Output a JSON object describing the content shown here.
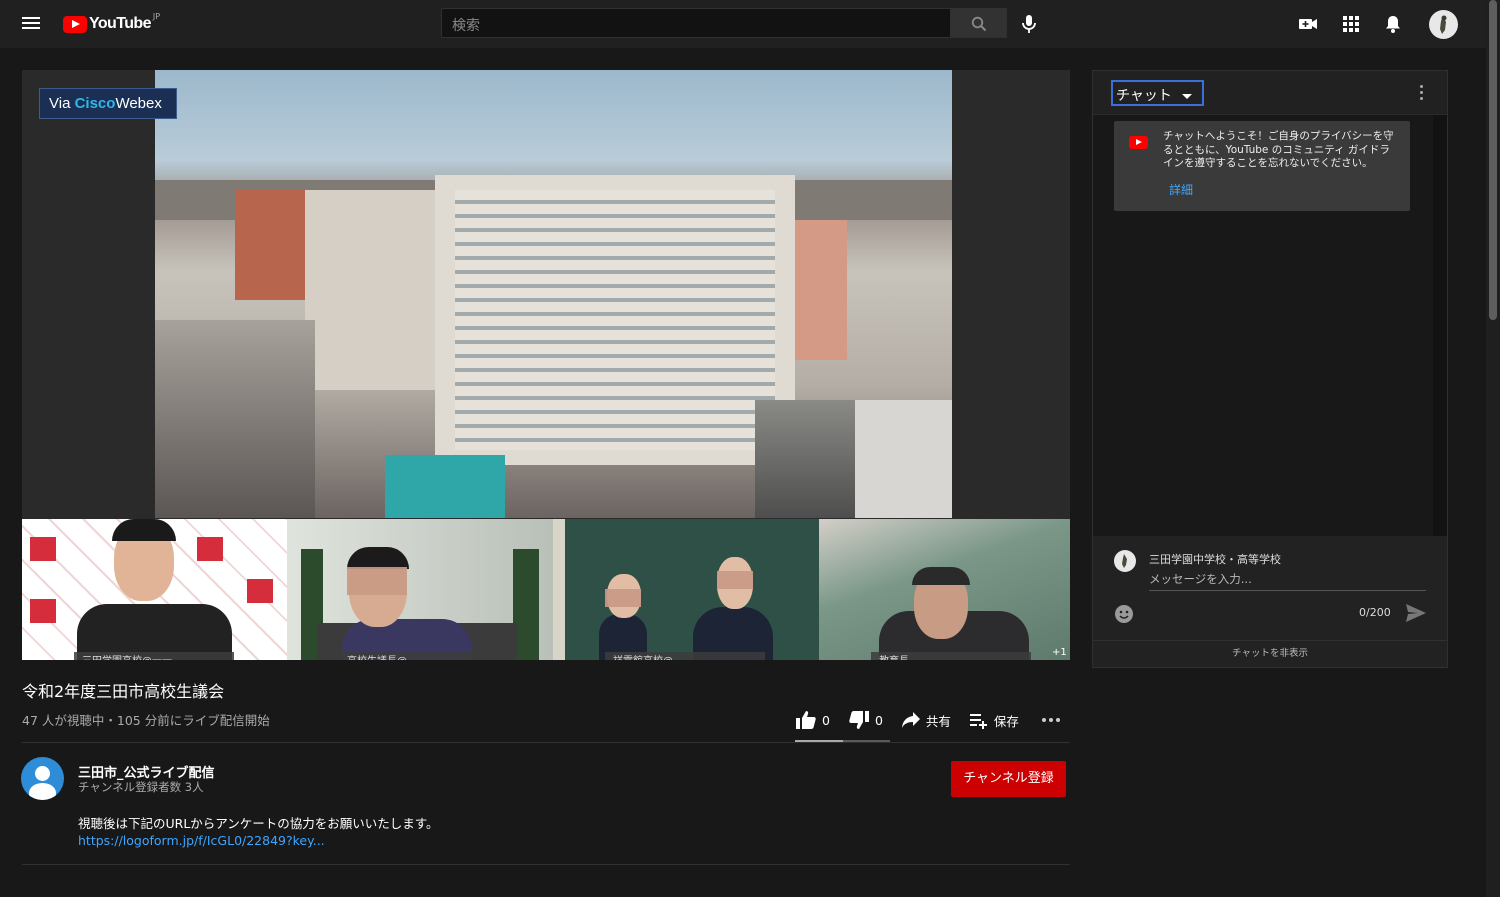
{
  "masthead": {
    "logo_text": "YouTube",
    "logo_region": "JP",
    "search_placeholder": "検索",
    "icons": [
      "menu-icon",
      "search-icon",
      "mic-icon",
      "video-camera-icon",
      "apps-icon",
      "bell-icon"
    ]
  },
  "player": {
    "overlay_badge": {
      "prefix": "Via ",
      "brand": "Cisco",
      "suffix": "Webex"
    },
    "participants": [
      {
        "label": "三田学園高校@一一"
      },
      {
        "label": "高校生議長@"
      },
      {
        "label": "祥雲館高校@"
      },
      {
        "label": "教育長"
      }
    ],
    "more_participants": "+1"
  },
  "video": {
    "title": "令和2年度三田市高校生議会",
    "view_info": "47 人が視聴中・105 分前にライブ配信開始",
    "likes": "0",
    "dislikes": "0",
    "like_ratio": 0.5,
    "share_label": "共有",
    "save_label": "保存"
  },
  "channel": {
    "name": "三田市_公式ライブ配信",
    "subscribers": "チャンネル登録者数 3人",
    "subscribe_label": "チャンネル登録",
    "description": "視聴後は下記のURLからアンケートの協力をお願いいたします。",
    "link": "https://logoform.jp/f/IcGL0/22849?key..."
  },
  "chat": {
    "mode_label": "チャット",
    "welcome_text": "チャットへようこそ！ご自身のプライバシーを守るとともに、YouTube のコミュニティ ガイドラインを遵守することを忘れないでください。",
    "welcome_link": "詳細",
    "user_name": "三田学園中学校・高等学校",
    "input_placeholder": "メッセージを入力...",
    "char_count": "0/200",
    "hide_label": "チャットを非表示"
  },
  "colors": {
    "background": "#181818",
    "accent_red": "#cc0000",
    "link_blue": "#3ea6ff",
    "focus_blue": "#3a6fd8"
  }
}
